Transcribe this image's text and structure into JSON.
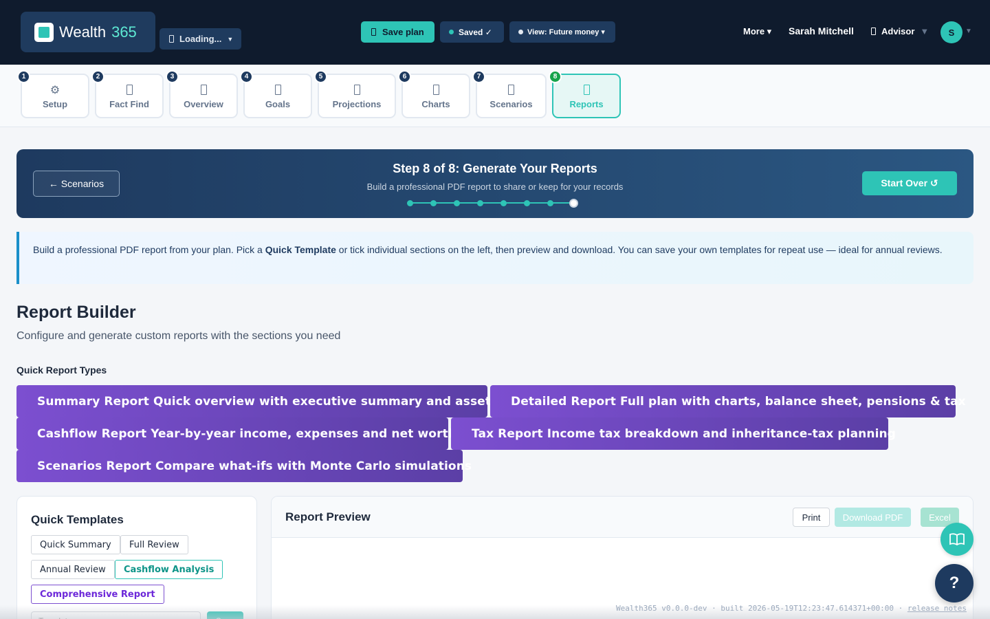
{
  "header": {
    "brand_name": "Wealth",
    "brand_num": "365",
    "loading_label": "Loading...",
    "save_label": "Save plan",
    "saved_label": "Saved ✓",
    "view_label": "View: Future money ▾",
    "more_label": "More ▾",
    "user_name": "Sarah Mitchell",
    "role_label": "Advisor",
    "avatar_initial": "S",
    "colors": {
      "bg": "#0f1b2d",
      "accent": "#2ec4b6"
    }
  },
  "steps": [
    {
      "num": "1",
      "label": "Setup",
      "icon": "gear-icon"
    },
    {
      "num": "2",
      "label": "Fact Find",
      "icon": "clipboard-icon"
    },
    {
      "num": "3",
      "label": "Overview",
      "icon": "dashboard-icon"
    },
    {
      "num": "4",
      "label": "Goals",
      "icon": "target-icon"
    },
    {
      "num": "5",
      "label": "Projections",
      "icon": "trend-icon"
    },
    {
      "num": "6",
      "label": "Charts",
      "icon": "chart-icon"
    },
    {
      "num": "7",
      "label": "Scenarios",
      "icon": "scenarios-icon"
    },
    {
      "num": "8",
      "label": "Reports",
      "icon": "report-icon"
    }
  ],
  "active_step": 8,
  "banner": {
    "back_label": "← Scenarios",
    "title": "Step 8 of 8: Generate Your Reports",
    "subtitle": "Build a professional PDF report to share or keep for your records",
    "start_over_label": "Start Over ↺",
    "progress_total": 8,
    "progress_current": 8
  },
  "info": {
    "text_1": "Build a professional PDF report from your plan. Pick a ",
    "bold": "Quick Template",
    "text_2": " or tick individual sections on the left, then preview and download. You can save your own templates for repeat use — ideal for annual reviews."
  },
  "report_builder": {
    "title": "Report Builder",
    "subtitle": "Configure and generate custom reports with the sections you need",
    "quick_types_label": "Quick Report Types",
    "quick_types": [
      "Summary Report Quick overview with executive summary and assets",
      "Detailed Report Full plan with charts, balance sheet, pensions & tax",
      "Cashflow Report Year-by-year income, expenses and net worth",
      "Tax Report Income tax breakdown and inheritance-tax planning",
      "Scenarios Report Compare what-ifs with Monte Carlo simulations"
    ]
  },
  "quick_templates": {
    "title": "Quick Templates",
    "items": [
      "Quick Summary",
      "Full Review",
      "Annual Review",
      "Cashflow Analysis",
      "Comprehensive Report"
    ],
    "input_placeholder": "Template name",
    "save_label": "Save"
  },
  "preview": {
    "title": "Report Preview",
    "print_label": "Print",
    "pdf_label": "Download PDF",
    "excel_label": "Excel"
  },
  "help_label": "?",
  "footer": {
    "version": "Wealth365 v0.0.0-dev · built 2026-05-19T12:23:47.614371+00:00 · ",
    "release_notes": "release notes"
  }
}
